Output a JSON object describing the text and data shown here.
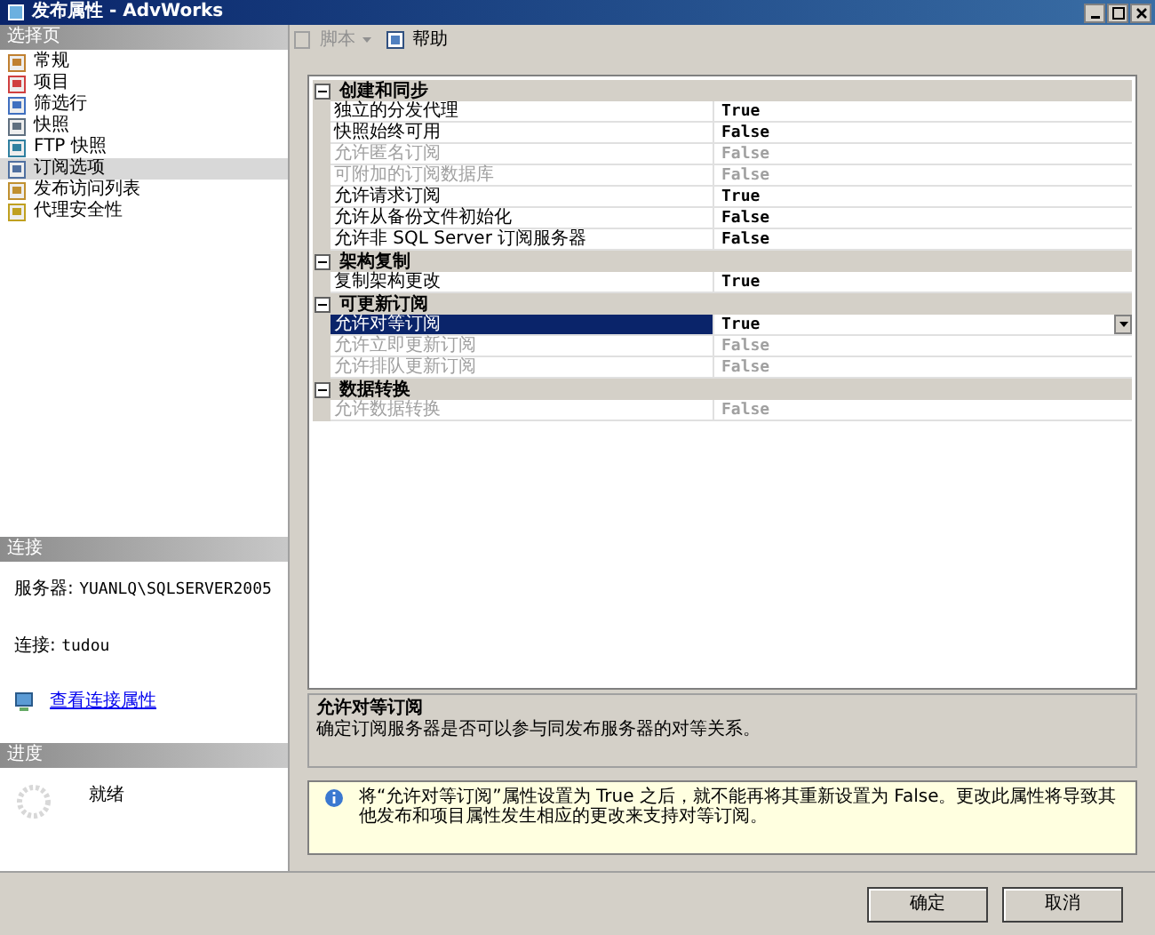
{
  "window": {
    "title": "发布属性 - AdvWorks"
  },
  "left": {
    "header": "选择页",
    "pages": [
      {
        "label": "常规",
        "selected": false
      },
      {
        "label": "项目",
        "selected": false
      },
      {
        "label": "筛选行",
        "selected": false
      },
      {
        "label": "快照",
        "selected": false
      },
      {
        "label": "FTP 快照",
        "selected": false
      },
      {
        "label": "订阅选项",
        "selected": true
      },
      {
        "label": "发布访问列表",
        "selected": false
      },
      {
        "label": "代理安全性",
        "selected": false
      }
    ],
    "connection": {
      "header": "连接",
      "server_label": "服务器:",
      "server": "YUANLQ\\SQLSERVER2005",
      "login_label": "连接:",
      "login": "tudou",
      "link": "查看连接属性"
    },
    "progress": {
      "header": "进度",
      "status": "就绪"
    }
  },
  "toolbar": {
    "script": {
      "label": "脚本",
      "disabled": true
    },
    "help": {
      "label": "帮助",
      "disabled": false
    }
  },
  "grid": {
    "categories": [
      {
        "name": "创建和同步",
        "expanded": true,
        "rows": [
          {
            "name": "独立的分发代理",
            "value": "True",
            "disabled": false,
            "selected": false
          },
          {
            "name": "快照始终可用",
            "value": "False",
            "disabled": false,
            "selected": false
          },
          {
            "name": "允许匿名订阅",
            "value": "False",
            "disabled": true,
            "selected": false
          },
          {
            "name": "可附加的订阅数据库",
            "value": "False",
            "disabled": true,
            "selected": false
          },
          {
            "name": "允许请求订阅",
            "value": "True",
            "disabled": false,
            "selected": false
          },
          {
            "name": "允许从备份文件初始化",
            "value": "False",
            "disabled": false,
            "selected": false
          },
          {
            "name": "允许非 SQL Server 订阅服务器",
            "value": "False",
            "disabled": false,
            "selected": false
          }
        ]
      },
      {
        "name": "架构复制",
        "expanded": true,
        "rows": [
          {
            "name": "复制架构更改",
            "value": "True",
            "disabled": false,
            "selected": false
          }
        ]
      },
      {
        "name": "可更新订阅",
        "expanded": true,
        "rows": [
          {
            "name": "允许对等订阅",
            "value": "True",
            "disabled": false,
            "selected": true
          },
          {
            "name": "允许立即更新订阅",
            "value": "False",
            "disabled": true,
            "selected": false
          },
          {
            "name": "允许排队更新订阅",
            "value": "False",
            "disabled": true,
            "selected": false
          }
        ]
      },
      {
        "name": "数据转换",
        "expanded": true,
        "rows": [
          {
            "name": "允许数据转换",
            "value": "False",
            "disabled": true,
            "selected": false
          }
        ]
      }
    ]
  },
  "description": {
    "title": "允许对等订阅",
    "text": "确定订阅服务器是否可以参与同发布服务器的对等关系。"
  },
  "info": {
    "text": "将“允许对等订阅”属性设置为 True 之后，就不能再将其重新设置为 False。更改此属性将导致其他发布和项目属性发生相应的更改来支持对等订阅。"
  },
  "buttons": [
    "确定",
    "取消"
  ]
}
